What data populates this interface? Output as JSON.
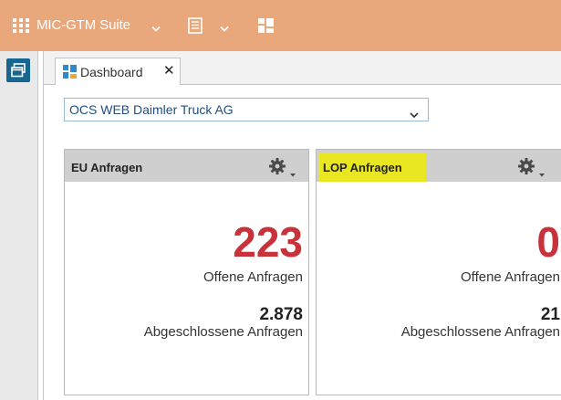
{
  "topbar": {
    "suite_label": "MIC-GTM Suite",
    "icons": [
      "app-grid-icon",
      "chevron-down-icon",
      "document-icon",
      "chevron-down-icon",
      "dashboard-icon"
    ],
    "background": "#e8a87c"
  },
  "tabs": [
    {
      "label": "Dashboard",
      "icon": "dashboard-icon",
      "close": "✕"
    }
  ],
  "organization_select": {
    "value": "OCS WEB Daimler Truck AG"
  },
  "panels": {
    "eu": {
      "title": "EU Anfragen",
      "open_count": "223",
      "open_label": "Offene Anfragen",
      "closed_count": "2.878",
      "closed_label": "Abgeschlossene Anfragen"
    },
    "lop": {
      "title": "LOP Anfragen",
      "title_highlight": "#e9e622",
      "open_count": "0",
      "open_label": "Offene Anfragen",
      "closed_count": "21",
      "closed_label": "Abgeschlossene Anfragen"
    }
  },
  "colors": {
    "accent_red": "#c8323b",
    "rail_button": "#16668f",
    "panel_header": "#cfcfcf"
  }
}
